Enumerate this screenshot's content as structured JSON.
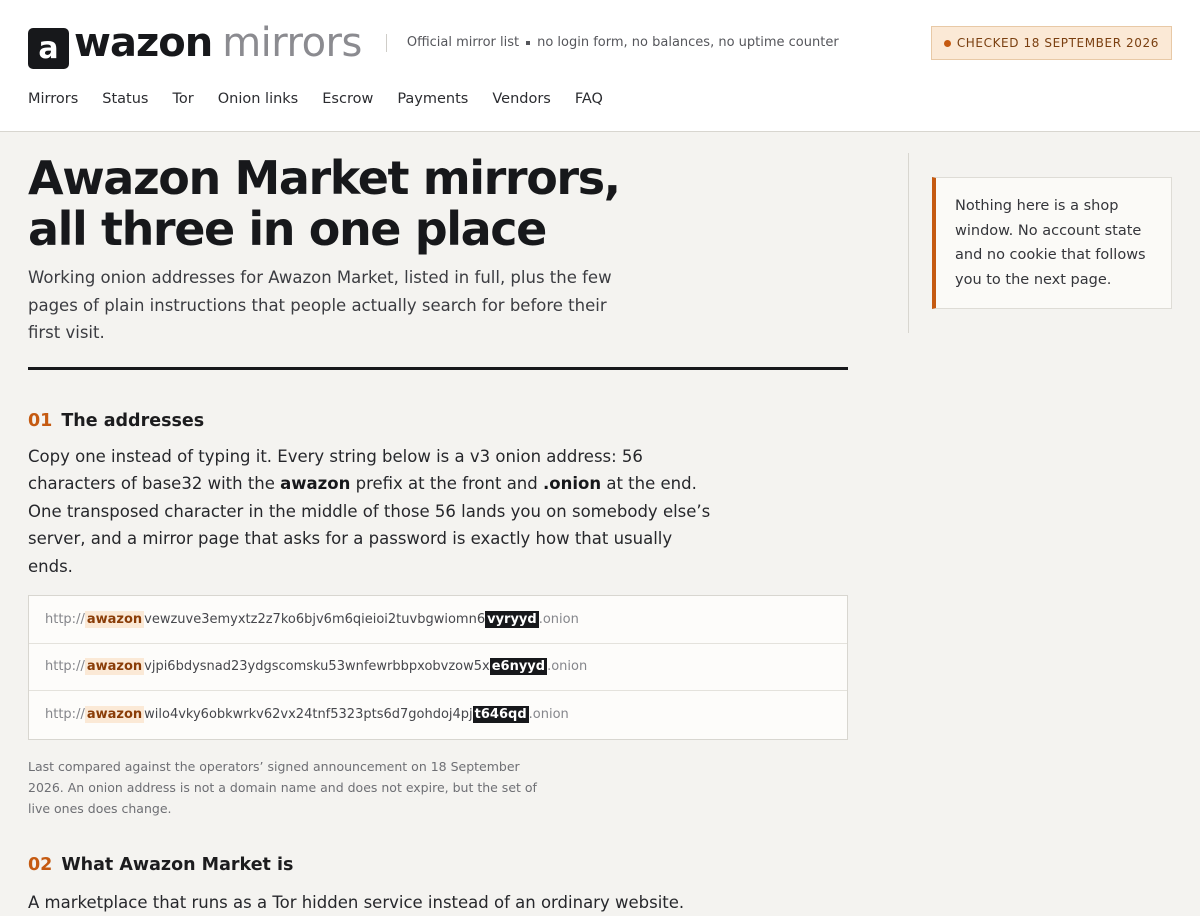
{
  "header": {
    "logo_letter": "a",
    "brand_word": "wazon",
    "brand_sub": "mirrors",
    "tagline": [
      "Official mirror list",
      "no login form, no balances, no uptime counter"
    ],
    "badge": "CHECKED 18 SEPTEMBER 2026"
  },
  "nav": [
    "Mirrors",
    "Status",
    "Tor",
    "Onion links",
    "Escrow",
    "Payments",
    "Vendors",
    "FAQ"
  ],
  "main": {
    "title_line1": "Awazon Market mirrors,",
    "title_line2": "all three in one place",
    "lead": "Working onion addresses for Awazon Market, listed in full, plus the few pages of plain instructions that people actually search for before their first visit.",
    "sections": [
      {
        "number": "01",
        "title": "The addresses",
        "text_parts": [
          "Copy one instead of typing it. Every string below is a v3 onion address: 56 characters of base32 with the ",
          "awazon",
          " prefix at the front and ",
          ".onion",
          " at the end. One transposed character in the middle of those 56 lands you on somebody else’s server, and a mirror page that asks for a password is exactly how that usually ends."
        ]
      },
      {
        "number": "02",
        "title": "What Awazon Market is",
        "text": "A marketplace that runs as a Tor hidden service instead of an ordinary website."
      }
    ],
    "addresses": [
      {
        "scheme": "http://",
        "prefix": "awazon",
        "middle": "vewzuve3emyxtz2z7ko6bjv6m6qieioi2tuvbgwiomn6",
        "suffix": "vyryyd",
        "tld": ".onion"
      },
      {
        "scheme": "http://",
        "prefix": "awazon",
        "middle": "vjpi6bdysnad23ydgscomsku53wnfewrbbpxobvzow5x",
        "suffix": "e6nyyd",
        "tld": ".onion"
      },
      {
        "scheme": "http://",
        "prefix": "awazon",
        "middle": "wilo4vky6obkwrkv62vx24tnf5323pts6d7gohdoj4pj",
        "suffix": "t646qd",
        "tld": ".onion"
      }
    ],
    "footnote": "Last compared against the operators’ signed announcement on 18 September 2026. An onion address is not a domain name and does not expire, but the set of live ones does change."
  },
  "aside": {
    "text": "Nothing here is a shop window. No account state and no cookie that follows you to the next page."
  },
  "colors": {
    "accent": "#c55a11",
    "ink": "#17181b",
    "background": "#f4f3f0",
    "badge_bg": "#fbe9d6"
  }
}
